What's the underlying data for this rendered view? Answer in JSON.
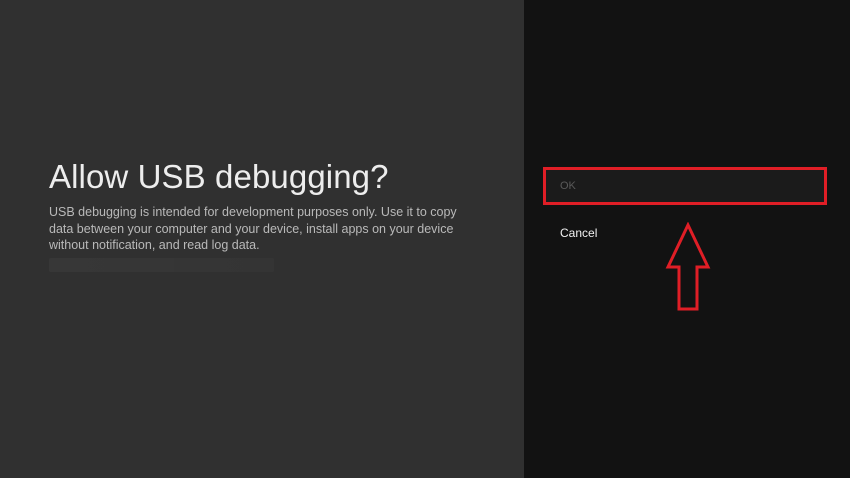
{
  "dialog": {
    "title": "Allow USB debugging?",
    "message": "USB debugging is intended for development purposes only. Use it to copy data between your computer and your device, install apps on your device without notification, and read log data."
  },
  "actions": {
    "ok_label": "OK",
    "cancel_label": "Cancel"
  },
  "annotation": {
    "highlight_color": "#e01e26",
    "arrow_icon": "up-arrow-icon"
  },
  "colors": {
    "left_panel": "#303030",
    "right_panel": "#121212"
  }
}
